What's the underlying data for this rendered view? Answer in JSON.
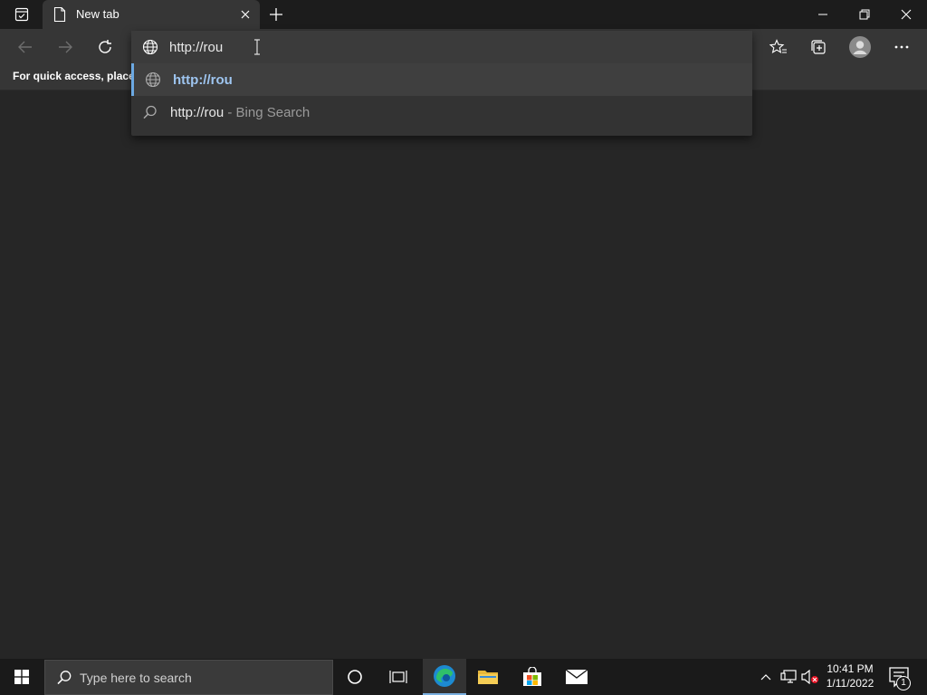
{
  "browser": {
    "tab": {
      "title": "New tab"
    },
    "favorites_bar": {
      "text": "For quick access, place y"
    },
    "omnibox": {
      "input_value": "http://rou",
      "suggestions": [
        {
          "text": "http://rou",
          "suffix": "",
          "icon": "globe-icon"
        },
        {
          "text": "http://rou",
          "suffix": " - Bing Search",
          "icon": "search-icon"
        }
      ]
    },
    "colors": {
      "accent": "#6ca9e3",
      "background": "#262626",
      "toolbar": "#363636"
    }
  },
  "taskbar": {
    "search_placeholder": "Type here to search",
    "clock": {
      "time": "10:41 PM",
      "date": "1/11/2022"
    },
    "notification_count": "1",
    "apps": [
      "cortana-icon",
      "task-view-icon",
      "edge-icon",
      "file-explorer-icon",
      "store-icon",
      "mail-icon"
    ]
  }
}
